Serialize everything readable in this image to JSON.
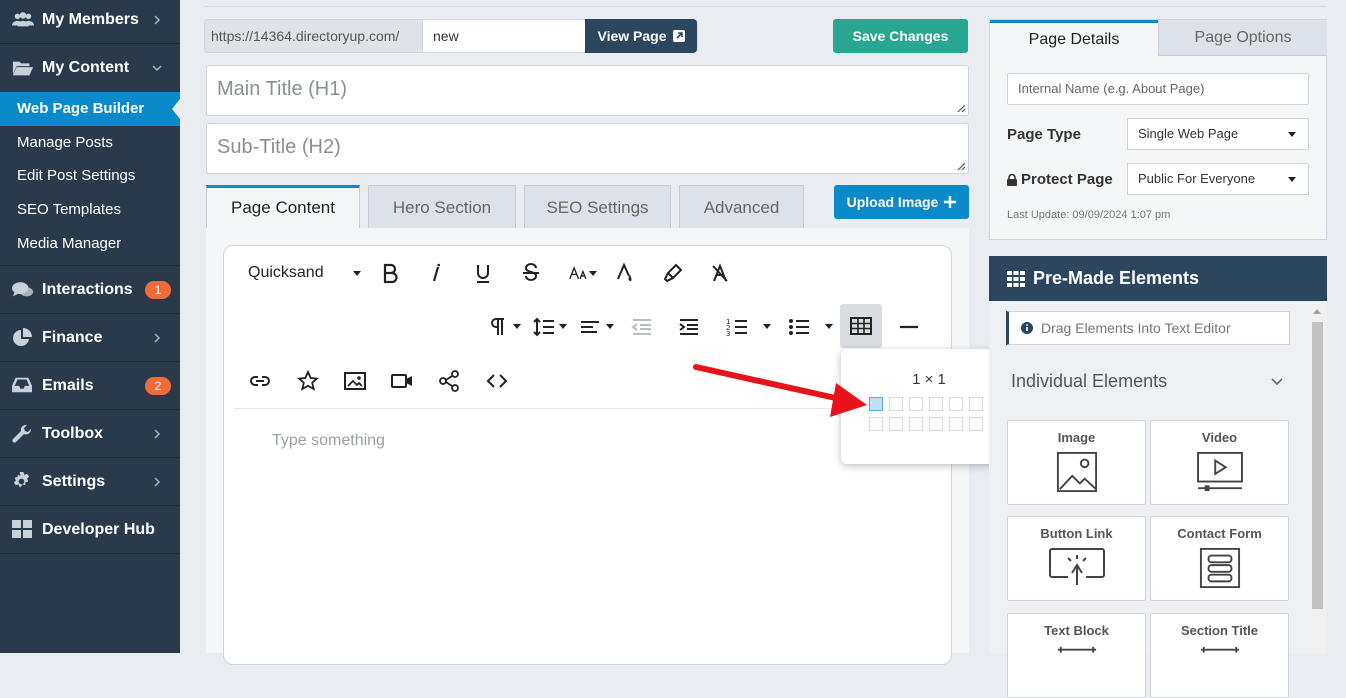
{
  "sidebar": {
    "main_items": [
      {
        "label": "My Members",
        "icon": "users-icon"
      },
      {
        "label": "My Content",
        "icon": "folder-open-icon"
      },
      {
        "label": "Interactions",
        "icon": "comments-icon",
        "badge": "1"
      },
      {
        "label": "Finance",
        "icon": "pie-chart-icon"
      },
      {
        "label": "Emails",
        "icon": "inbox-icon",
        "badge": "2"
      },
      {
        "label": "Toolbox",
        "icon": "wrench-icon"
      },
      {
        "label": "Settings",
        "icon": "gear-icon"
      },
      {
        "label": "Developer Hub",
        "icon": "grid-icon"
      }
    ],
    "sub_items": [
      {
        "label": "Web Page Builder",
        "active": true
      },
      {
        "label": "Manage Posts"
      },
      {
        "label": "Edit Post Settings"
      },
      {
        "label": "SEO Templates"
      },
      {
        "label": "Media Manager"
      }
    ]
  },
  "url_bar": {
    "prefix": "https://14364.directoryup.com/",
    "slug": "new"
  },
  "buttons": {
    "view_page": "View Page",
    "save_changes": "Save Changes",
    "upload_image": "Upload Image"
  },
  "fields": {
    "main_title_placeholder": "Main Title (H1)",
    "sub_title_placeholder": "Sub-Title (H2)"
  },
  "content_tabs": [
    "Page Content",
    "Hero Section",
    "SEO Settings",
    "Advanced"
  ],
  "editor": {
    "font_family": "Quicksand",
    "placeholder": "Type something"
  },
  "table_picker": {
    "size_label": "1 × 1",
    "rows": 2,
    "cols": 6,
    "selected_rows": 1,
    "selected_cols": 1
  },
  "page_details": {
    "tabs": [
      "Page Details",
      "Page Options"
    ],
    "internal_name_placeholder": "Internal Name (e.g. About Page)",
    "page_type_label": "Page Type",
    "page_type_value": "Single Web Page",
    "protect_page_label": "Protect Page",
    "protect_page_value": "Public For Everyone",
    "last_update": "Last Update: 09/09/2024 1:07 pm"
  },
  "premade": {
    "title": "Pre-Made Elements",
    "hint": "Drag Elements Into Text Editor",
    "section": "Individual Elements",
    "elements": [
      "Image",
      "Video",
      "Button Link",
      "Contact Form",
      "Text Block",
      "Section Title"
    ]
  },
  "colors": {
    "sidebar_bg": "#2b3a4a",
    "accent_blue": "#0b8ac9",
    "save_green": "#28a690",
    "navy": "#2c4660",
    "badge_orange": "#f26b3a",
    "annotation_red": "#e8121a"
  }
}
